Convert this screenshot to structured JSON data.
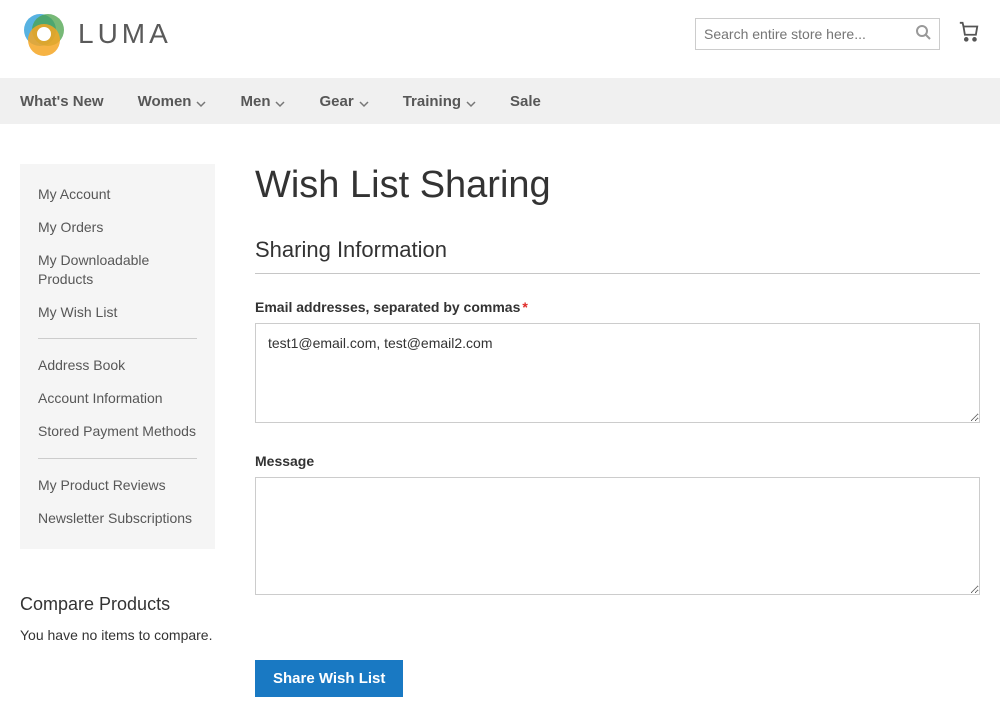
{
  "brand": {
    "name": "LUMA"
  },
  "search": {
    "placeholder": "Search entire store here..."
  },
  "nav": {
    "whats_new": "What's New",
    "women": "Women",
    "men": "Men",
    "gear": "Gear",
    "training": "Training",
    "sale": "Sale"
  },
  "sidebar": {
    "my_account": "My Account",
    "my_orders": "My Orders",
    "my_downloadable": "My Downloadable Products",
    "my_wish_list": "My Wish List",
    "address_book": "Address Book",
    "account_info": "Account Information",
    "stored_payment": "Stored Payment Methods",
    "product_reviews": "My Product Reviews",
    "newsletter": "Newsletter Subscriptions"
  },
  "compare": {
    "title": "Compare Products",
    "empty_text": "You have no items to compare."
  },
  "page": {
    "title": "Wish List Sharing",
    "section_title": "Sharing Information",
    "emails_label": "Email addresses, separated by commas",
    "emails_value": "test1@email.com, test@email2.com",
    "message_label": "Message",
    "message_value": "",
    "submit_label": "Share Wish List"
  }
}
